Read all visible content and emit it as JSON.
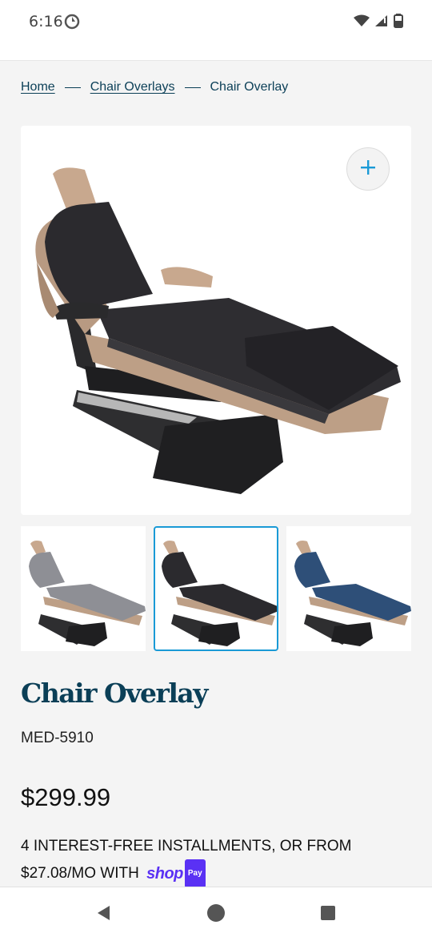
{
  "status": {
    "time": "6:16"
  },
  "breadcrumb": {
    "home": "Home",
    "category": "Chair Overlays",
    "current": "Chair Overlay"
  },
  "product": {
    "title": "Chair Overlay",
    "sku": "MED-5910",
    "price": "$299.99",
    "installments_line1": "4 interest-free installments, or from",
    "installments_amount": "$27.08/mo with",
    "shop_word": "shop",
    "pay_badge": "Pay"
  },
  "gallery": {
    "selected_index": 1,
    "thumbnails": [
      {
        "color_name": "gray",
        "color": "#8e8f95"
      },
      {
        "color_name": "black",
        "color": "#2b2a2e"
      },
      {
        "color_name": "blue",
        "color": "#2e4f78"
      }
    ]
  },
  "colors": {
    "accent": "#0b3f57",
    "selection": "#1a9ad6",
    "shop_pay": "#5a31f4",
    "chair_tan": "#c8a88e",
    "overlay_black": "#2b2a2e"
  },
  "icons": {
    "status_left": "sync-icon",
    "wifi": "wifi-icon",
    "signal": "signal-icon",
    "battery": "battery-icon",
    "zoom": "plus-icon",
    "nav_back": "back-triangle-icon",
    "nav_home": "home-circle-icon",
    "nav_recents": "recents-square-icon"
  }
}
